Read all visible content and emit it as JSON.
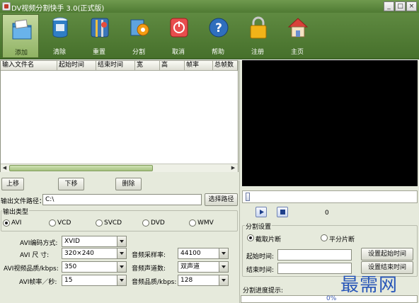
{
  "window": {
    "title": "DV视频分割快手 3.0(正式版)",
    "controls": [
      "_",
      "□",
      "×"
    ]
  },
  "toolbar": {
    "items": [
      {
        "label": "添加",
        "icon": "folder-add-icon",
        "active": true
      },
      {
        "label": "清除",
        "icon": "trash-icon"
      },
      {
        "label": "重置",
        "icon": "tools-icon"
      },
      {
        "label": "分割",
        "icon": "split-gear-icon"
      },
      {
        "label": "取消",
        "icon": "cancel-icon"
      },
      {
        "label": "帮助",
        "icon": "help-icon"
      },
      {
        "label": "注册",
        "icon": "lock-icon"
      },
      {
        "label": "主页",
        "icon": "home-icon"
      }
    ]
  },
  "file_table": {
    "columns": [
      "输入文件名",
      "起始时间",
      "结束时间",
      "宽",
      "高",
      "帧率",
      "总帧数"
    ],
    "rows": []
  },
  "list_buttons": {
    "up": "上移",
    "down": "下移",
    "delete": "删除"
  },
  "output_path": {
    "label": "输出文件路径：",
    "value": "C:\\",
    "browse": "选择路径"
  },
  "output_type": {
    "title": "输出类型",
    "options": [
      "AVI",
      "VCD",
      "SVCD",
      "DVD",
      "WMV"
    ],
    "selected": "AVI"
  },
  "settings": {
    "codec_label": "AVI编码方式:",
    "codec_value": "XVID",
    "size_label": "AVI 尺 寸:",
    "size_value": "320×240",
    "quality_label": "AVI视频品质/kbps:",
    "quality_value": "350",
    "fps_label": "AVI帧率／秒:",
    "fps_value": "15",
    "sample_rate_label": "音频采样率:",
    "sample_rate_value": "44100",
    "channels_label": "音频声道数:",
    "channels_value": "双声道",
    "audio_quality_label": "音频品质/kbps:",
    "audio_quality_value": "128"
  },
  "player": {
    "position_readout": "0"
  },
  "split_settings": {
    "title": "分割设置",
    "mode_options": [
      "截取片断",
      "平分片断"
    ],
    "mode_selected": "截取片断",
    "start_label": "起始时间:",
    "start_value": "",
    "end_label": "结束时间:",
    "end_value": "",
    "set_start_button": "设置起始时间",
    "set_end_button": "设置结束时间"
  },
  "progress": {
    "label": "分割进度提示:",
    "percent_text": "0%",
    "value": 0
  },
  "watermark": "最需网",
  "colors": {
    "toolbar_green": "#4f7a33",
    "panel_bg": "#e6eadc",
    "video_bg": "#000000",
    "watermark_blue": "#2856b8"
  }
}
